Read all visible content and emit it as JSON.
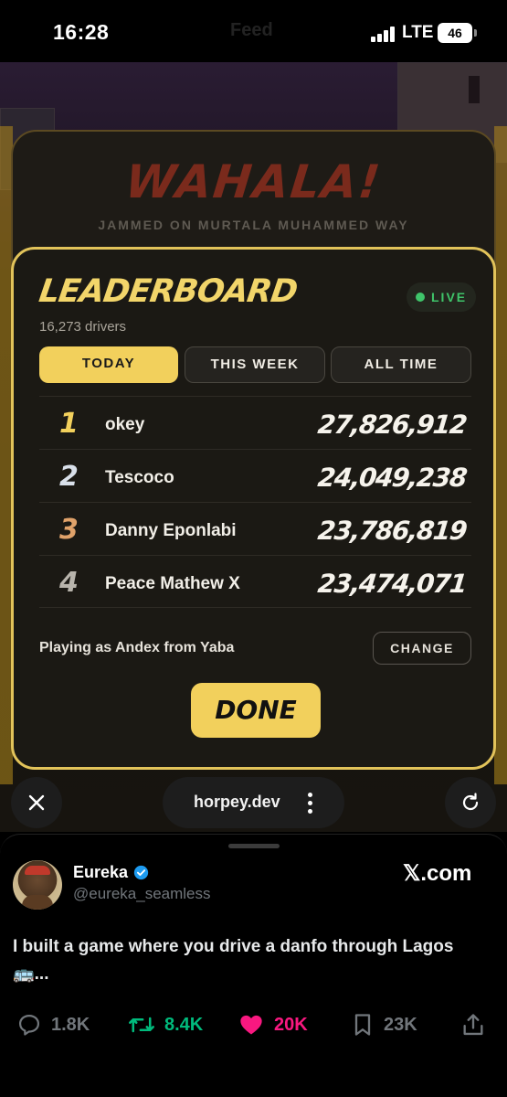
{
  "status_bar": {
    "time": "16:28",
    "ghost_title": "Feed",
    "network": "LTE",
    "battery": "46"
  },
  "game": {
    "banner_title": "WAHALA!",
    "banner_subtitle": "JAMMED ON MURTALA MUHAMMED WAY",
    "leaderboard": {
      "title": "LEADERBOARD",
      "live_label": "LIVE",
      "drivers_count": "16,273 drivers",
      "tabs": [
        "TODAY",
        "THIS WEEK",
        "ALL TIME"
      ],
      "active_tab": "TODAY",
      "rows": [
        {
          "rank": "1",
          "name": "okey",
          "score": "27,826,912",
          "rank_color": "#f2d05c"
        },
        {
          "rank": "2",
          "name": "Tescoco",
          "score": "24,049,238",
          "rank_color": "#d9e0ea"
        },
        {
          "rank": "3",
          "name": "Danny Eponlabi",
          "score": "23,786,819",
          "rank_color": "#e0a26a"
        },
        {
          "rank": "4",
          "name": "Peace Mathew X",
          "score": "23,474,071",
          "rank_color": "#b8b4ac"
        }
      ],
      "playing_as": "Playing as Andex from Yaba",
      "change_label": "CHANGE",
      "done_label": "DONE"
    }
  },
  "browser_bar": {
    "url": "horpey.dev",
    "close_icon": "close-icon",
    "menu_icon": "more-vertical-icon",
    "reload_icon": "reload-icon"
  },
  "tweet": {
    "author": "Eureka",
    "handle": "@eureka_seamless",
    "source": "𝕏.com",
    "text": "I built a game where you drive a danfo through Lagos 🚌...",
    "stats": {
      "replies": "1.8K",
      "retweets": "8.4K",
      "likes": "20K",
      "bookmarks": "23K"
    }
  },
  "colors": {
    "accent_yellow": "#f2d05c",
    "live_green": "#3fc46a",
    "retweet_green": "#00ba7c",
    "like_pink": "#f91880",
    "verified_blue": "#1d9bf0"
  }
}
